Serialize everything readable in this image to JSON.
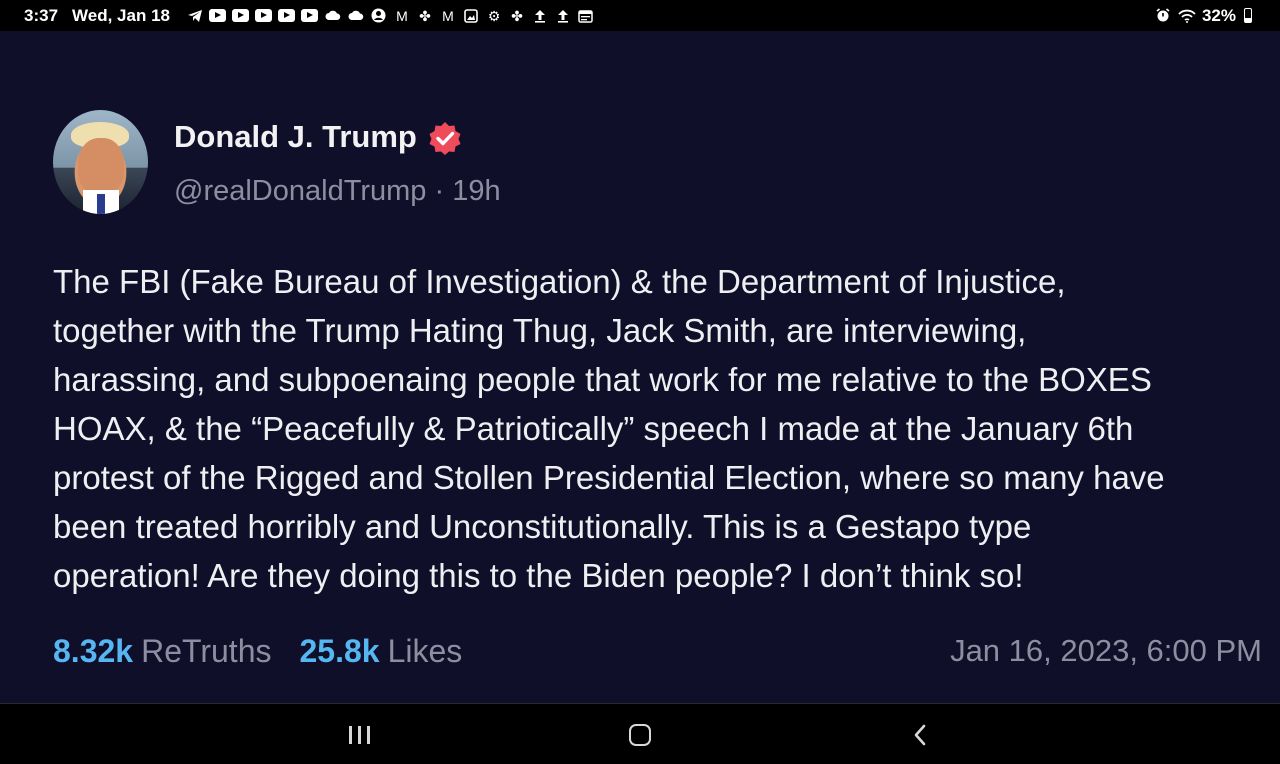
{
  "status_bar": {
    "time": "3:37",
    "date": "Wed, Jan 18",
    "battery": "32%",
    "notification_icons": [
      "telegram-icon",
      "youtube-icon",
      "youtube-icon",
      "youtube-icon",
      "youtube-icon",
      "youtube-icon",
      "cloud-icon",
      "cloud-icon",
      "account-icon",
      "gmail-icon",
      "pinwheel-icon",
      "gmail-icon",
      "gallery-icon",
      "settings-icon",
      "pinwheel-icon",
      "upload-icon",
      "upload-icon",
      "calendar-icon"
    ],
    "right_icons": [
      "alarm-icon",
      "wifi-icon",
      "battery-icon"
    ]
  },
  "post": {
    "display_name": "Donald J. Trump",
    "verified": true,
    "handle": "@realDonaldTrump",
    "separator": "·",
    "age": "19h",
    "text": "The FBI (Fake Bureau of Investigation) & the Department of Injustice,\ntogether with the Trump Hating Thug, Jack Smith, are interviewing,\nharassing, and subpoenaing people that work for me relative to the BOXES\nHOAX, & the “Peacefully & Patriotically” speech I made at the January 6th\nprotest of the Rigged and Stollen Presidential Election, where so many have\nbeen treated horribly and Unconstitutionally. This is a Gestapo type\noperation! Are they doing this to the Biden people? I don’t think so!",
    "retruths_count": "8.32k",
    "retruths_label": "ReTruths",
    "likes_count": "25.8k",
    "likes_label": "Likes",
    "timestamp": "Jan 16, 2023, 6:00 PM"
  },
  "nav_bar": {
    "buttons": [
      "recents-button",
      "home-button",
      "back-button"
    ]
  },
  "colors": {
    "background": "#0f0f2a",
    "accent": "#56b6f2",
    "muted": "#8e8ea0",
    "verified_badge": "#ee4b5b"
  }
}
